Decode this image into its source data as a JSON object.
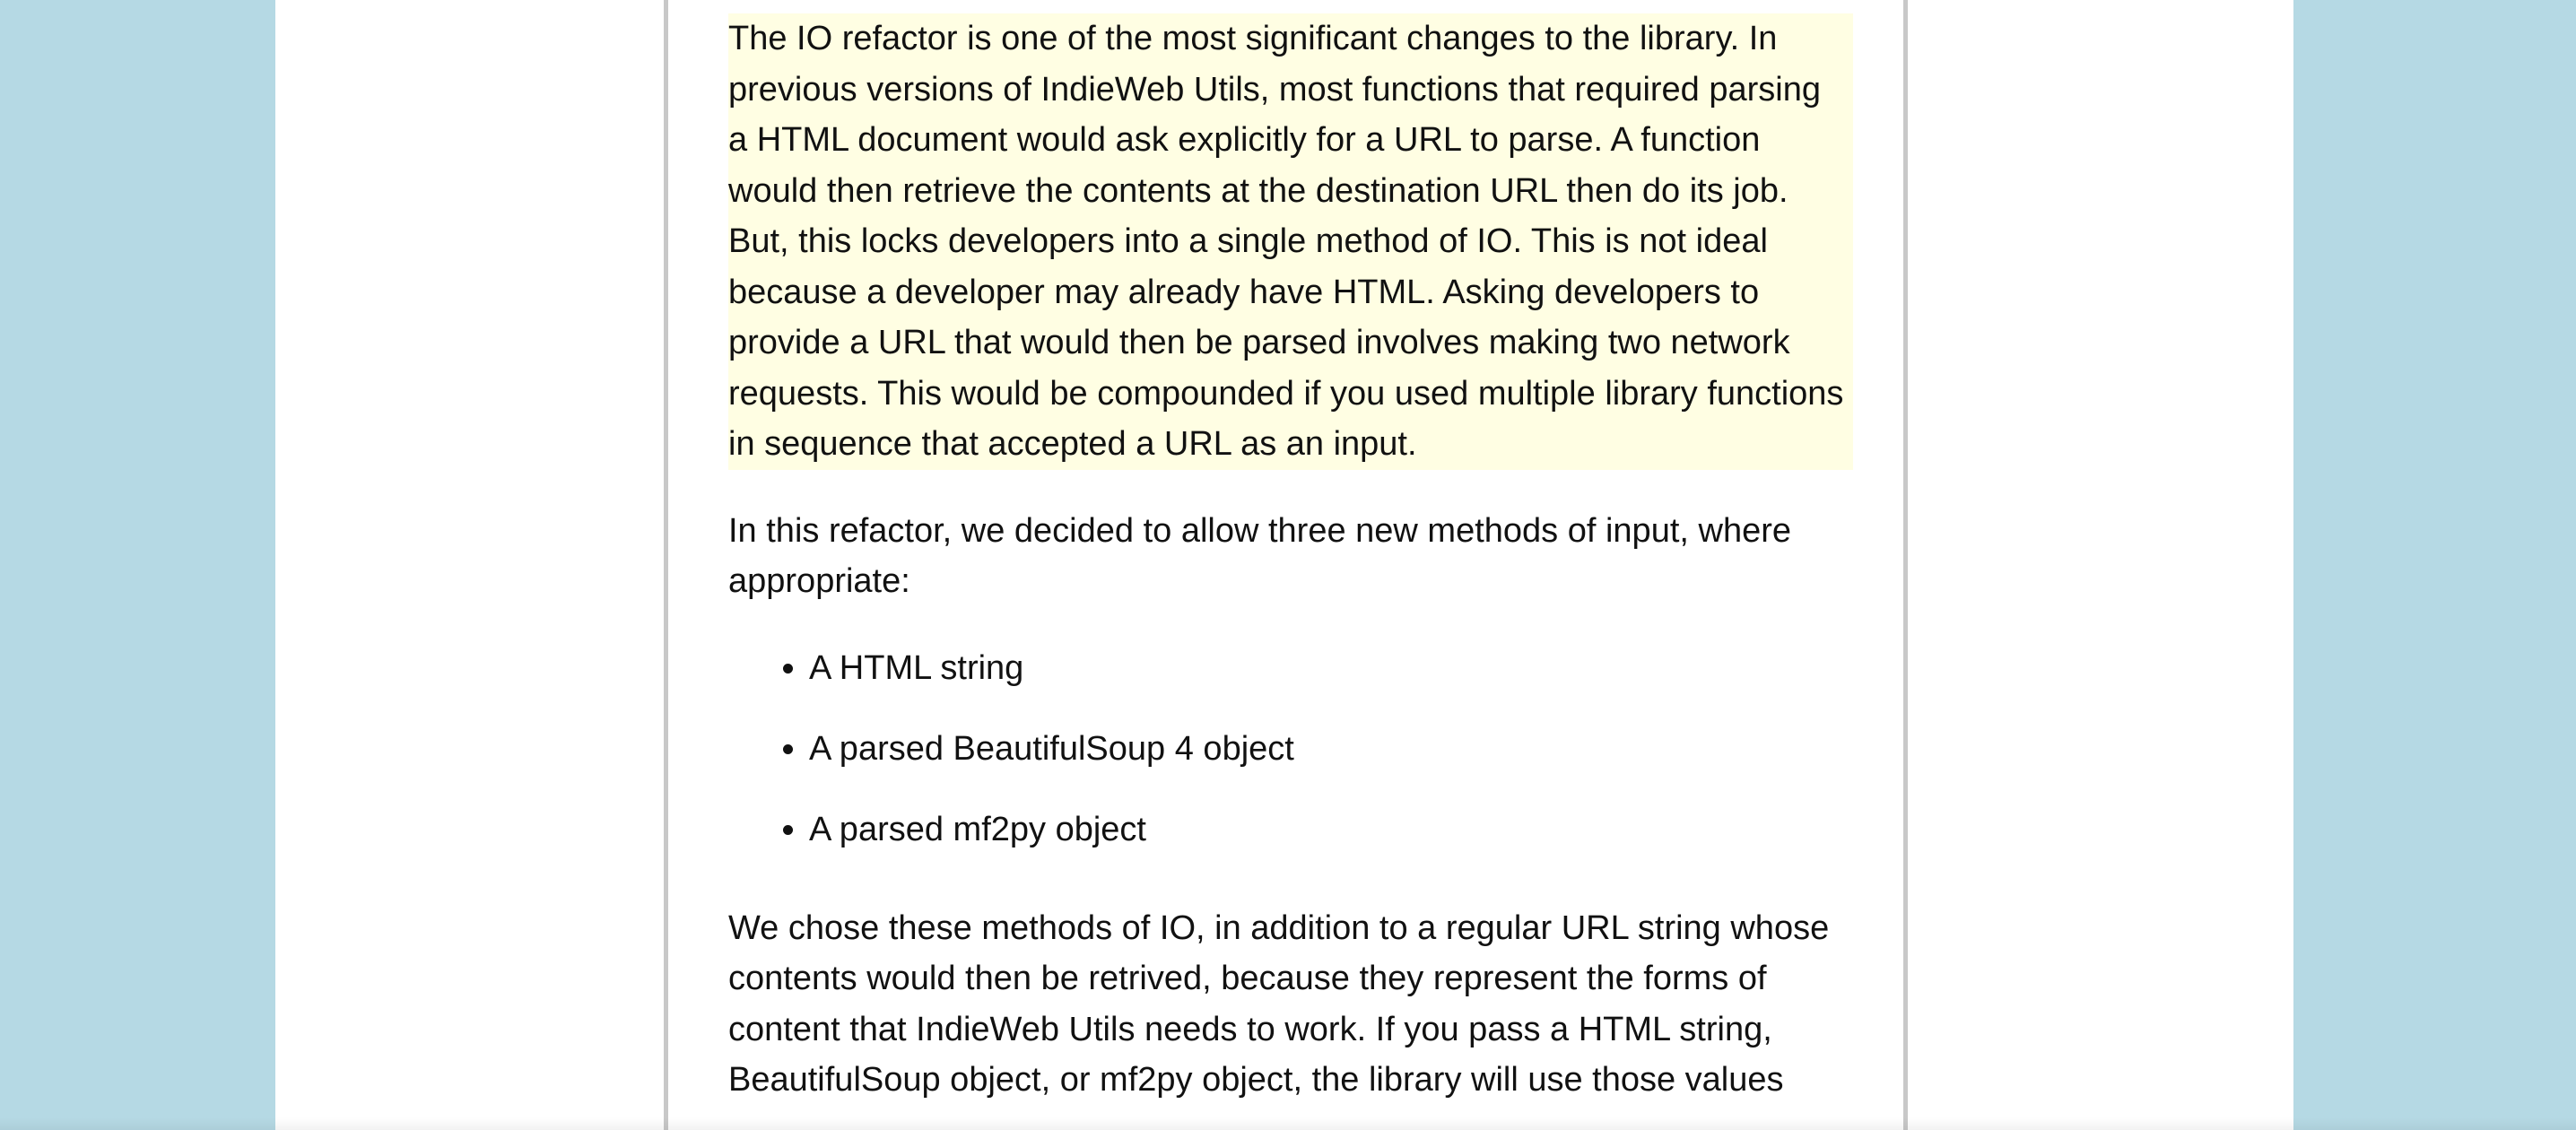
{
  "article": {
    "highlighted_paragraph": "The IO refactor is one of the most significant changes to the library. In previous versions of IndieWeb Utils, most functions that required parsing a HTML document would ask explicitly for a URL to parse. A function would then retrieve the contents at the destination URL then do its job. But, this locks developers into a single method of IO. This is not ideal because a developer may already have HTML. Asking developers to provide a URL that would then be parsed involves making two network requests. This would be compounded if you used multiple library functions in sequence that accepted a URL as an input.",
    "intro_paragraph": "In this refactor, we decided to allow three new methods of input, where appropriate:",
    "input_methods": [
      "A HTML string",
      "A parsed BeautifulSoup 4 object",
      "A parsed mf2py object"
    ],
    "closing_paragraph": "We chose these methods of IO, in addition to a regular URL string whose contents would then be retrived, because they represent the forms of content that IndieWeb Utils needs to work. If you pass a HTML string, BeautifulSoup object, or mf2py object, the library will use those values"
  }
}
